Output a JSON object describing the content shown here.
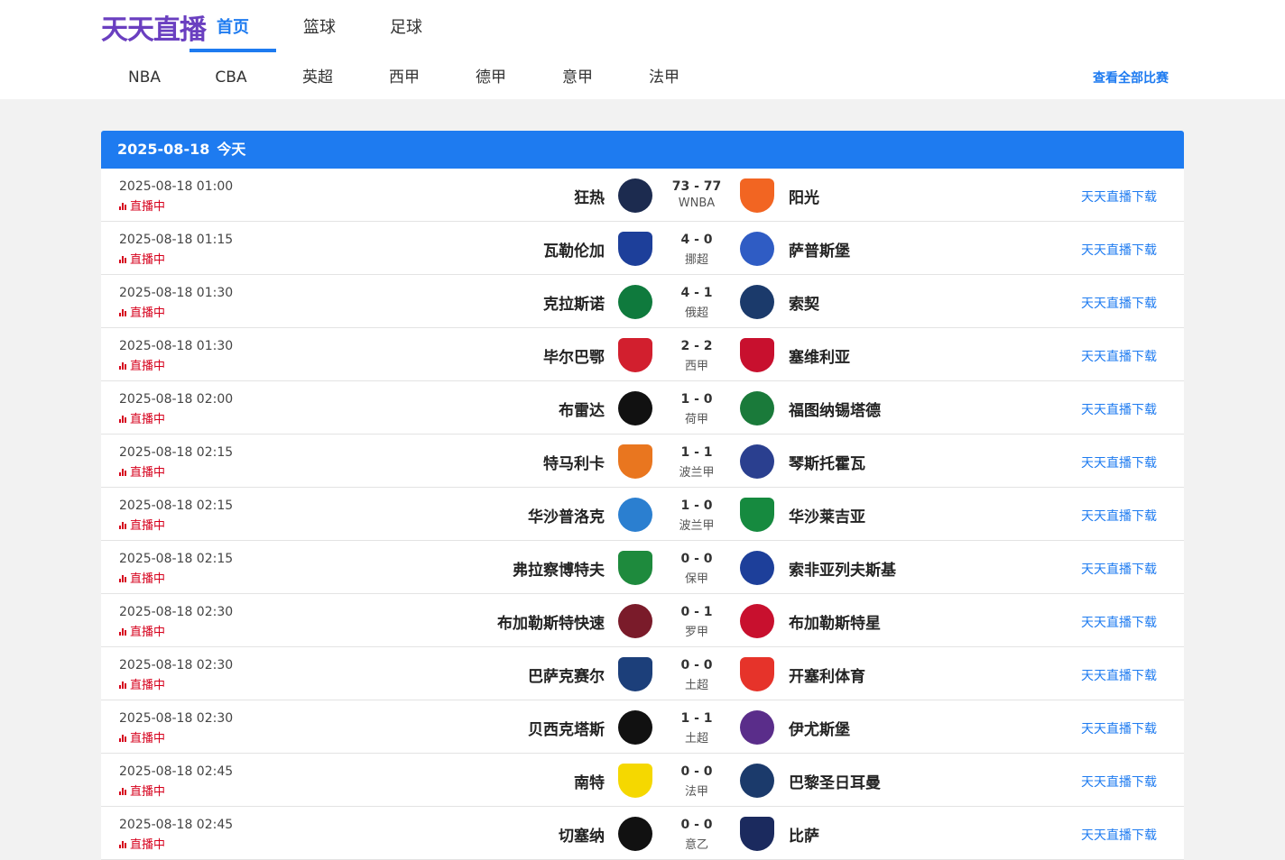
{
  "header": {
    "logo": "天天直播",
    "main_nav": [
      "首页",
      "篮球",
      "足球"
    ],
    "league_nav": [
      "NBA",
      "CBA",
      "英超",
      "西甲",
      "德甲",
      "意甲",
      "法甲"
    ],
    "view_all": "查看全部比赛"
  },
  "colors": {
    "accent": "#1e7bf0",
    "live": "#d6001c",
    "logo": "#6a3fc0"
  },
  "section": {
    "date": "2025-08-18",
    "day_label": "今天"
  },
  "matches": [
    {
      "time": "2025-08-18 01:00",
      "status": "直播中",
      "home": "狂热",
      "score": "73 - 77",
      "league": "WNBA",
      "away": "阳光",
      "link": "天天直播下载",
      "home_color": "#1c2b4f",
      "away_color": "#f26522"
    },
    {
      "time": "2025-08-18 01:15",
      "status": "直播中",
      "home": "瓦勒伦加",
      "score": "4 - 0",
      "league": "挪超",
      "away": "萨普斯堡",
      "link": "天天直播下载",
      "home_color": "#1d3f9a",
      "away_color": "#2f5cc4"
    },
    {
      "time": "2025-08-18 01:30",
      "status": "直播中",
      "home": "克拉斯诺",
      "score": "4 - 1",
      "league": "俄超",
      "away": "索契",
      "link": "天天直播下载",
      "home_color": "#0f7a3d",
      "away_color": "#1b3a6b"
    },
    {
      "time": "2025-08-18 01:30",
      "status": "直播中",
      "home": "毕尔巴鄂",
      "score": "2 - 2",
      "league": "西甲",
      "away": "塞维利亚",
      "link": "天天直播下载",
      "home_color": "#d21f2e",
      "away_color": "#c8102e"
    },
    {
      "time": "2025-08-18 02:00",
      "status": "直播中",
      "home": "布雷达",
      "score": "1 - 0",
      "league": "荷甲",
      "away": "福图纳锡塔德",
      "link": "天天直播下载",
      "home_color": "#111111",
      "away_color": "#1a7a3a"
    },
    {
      "time": "2025-08-18 02:15",
      "status": "直播中",
      "home": "特马利卡",
      "score": "1 - 1",
      "league": "波兰甲",
      "away": "琴斯托霍瓦",
      "link": "天天直播下载",
      "home_color": "#e9761f",
      "away_color": "#2a3f8f"
    },
    {
      "time": "2025-08-18 02:15",
      "status": "直播中",
      "home": "华沙普洛克",
      "score": "1 - 0",
      "league": "波兰甲",
      "away": "华沙莱吉亚",
      "link": "天天直播下载",
      "home_color": "#2b7fd0",
      "away_color": "#168a3f"
    },
    {
      "time": "2025-08-18 02:15",
      "status": "直播中",
      "home": "弗拉察博特夫",
      "score": "0 - 0",
      "league": "保甲",
      "away": "索非亚列夫斯基",
      "link": "天天直播下载",
      "home_color": "#1e8a3d",
      "away_color": "#1d3f9a"
    },
    {
      "time": "2025-08-18 02:30",
      "status": "直播中",
      "home": "布加勒斯特快速",
      "score": "0 - 1",
      "league": "罗甲",
      "away": "布加勒斯特星",
      "link": "天天直播下载",
      "home_color": "#7a1b2a",
      "away_color": "#c8102e"
    },
    {
      "time": "2025-08-18 02:30",
      "status": "直播中",
      "home": "巴萨克赛尔",
      "score": "0 - 0",
      "league": "土超",
      "away": "开塞利体育",
      "link": "天天直播下载",
      "home_color": "#1c3f7a",
      "away_color": "#e6332a"
    },
    {
      "time": "2025-08-18 02:30",
      "status": "直播中",
      "home": "贝西克塔斯",
      "score": "1 - 1",
      "league": "土超",
      "away": "伊尤斯堡",
      "link": "天天直播下载",
      "home_color": "#111111",
      "away_color": "#5a2d8a"
    },
    {
      "time": "2025-08-18 02:45",
      "status": "直播中",
      "home": "南特",
      "score": "0 - 0",
      "league": "法甲",
      "away": "巴黎圣日耳曼",
      "link": "天天直播下载",
      "home_color": "#f5d800",
      "away_color": "#1b3a6b"
    },
    {
      "time": "2025-08-18 02:45",
      "status": "直播中",
      "home": "切塞纳",
      "score": "0 - 0",
      "league": "意乙",
      "away": "比萨",
      "link": "天天直播下载",
      "home_color": "#111111",
      "away_color": "#1b2a5e"
    }
  ]
}
